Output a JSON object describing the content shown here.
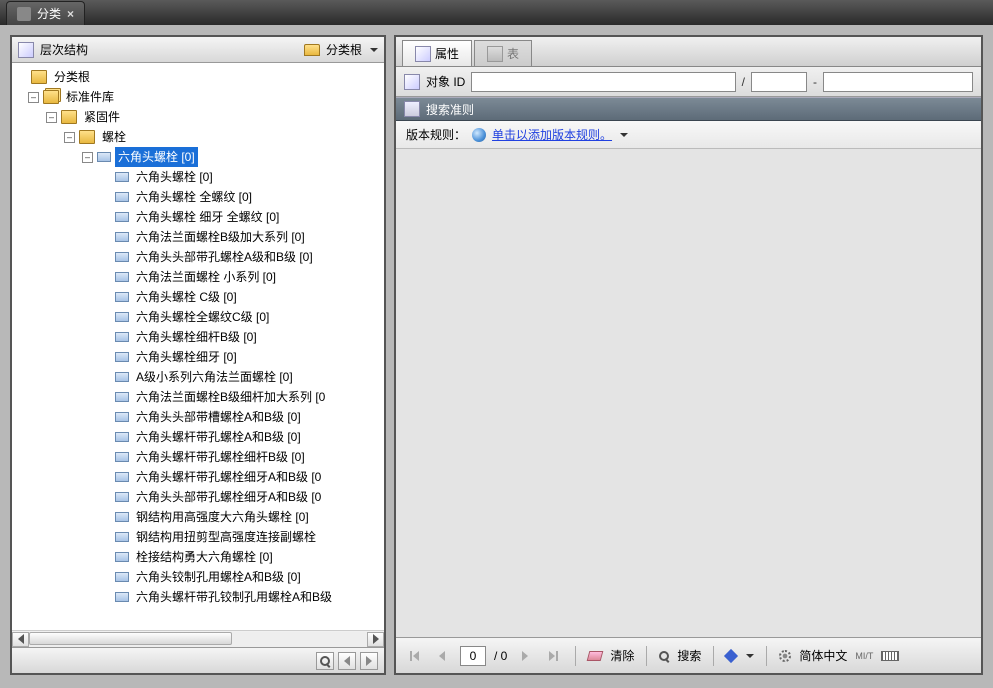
{
  "window": {
    "tab_title": "分类",
    "tab_close": "×"
  },
  "left_panel": {
    "header_title": "层次结构",
    "header_dropdown": "分类根",
    "tree": {
      "root": "分类根",
      "lib": "标准件库",
      "fastener": "紧固件",
      "bolt": "螺栓",
      "selected": "六角头螺栓  [0]",
      "items": [
        "六角头螺栓  [0]",
        "六角头螺栓 全螺纹  [0]",
        "六角头螺栓 细牙 全螺纹  [0]",
        "六角法兰面螺栓B级加大系列  [0]",
        "六角头头部带孔螺栓A级和B级  [0]",
        "六角法兰面螺栓 小系列  [0]",
        "六角头螺栓 C级  [0]",
        "六角头螺栓全螺纹C级  [0]",
        "六角头螺栓细杆B级  [0]",
        "六角头螺栓细牙  [0]",
        "A级小系列六角法兰面螺栓  [0]",
        "六角法兰面螺栓B级细杆加大系列  [0",
        "六角头头部带槽螺栓A和B级  [0]",
        "六角头螺杆带孔螺栓A和B级  [0]",
        "六角头螺杆带孔螺栓细杆B级  [0]",
        "六角头螺杆带孔螺栓细牙A和B级  [0",
        "六角头头部带孔螺栓细牙A和B级  [0",
        "钢结构用高强度大六角头螺栓  [0]",
        "钢结构用扭剪型高强度连接副螺栓  ",
        "栓接结构勇大六角螺栓  [0]",
        "六角头铰制孔用螺栓A和B级  [0]",
        "六角头螺杆带孔铰制孔用螺栓A和B级"
      ]
    }
  },
  "right_panel": {
    "tabs": {
      "props": "属性",
      "table": "表"
    },
    "obj_id_label": "对象 ID",
    "obj_id_sep1": "/",
    "obj_id_sep2": "-",
    "search_criteria_title": "搜索准则",
    "version_rule_label": "版本规则：",
    "version_rule_link": "单击以添加版本规则。"
  },
  "footer": {
    "page_current": "0",
    "page_sep": "/ 0",
    "clear": "清除",
    "search": "搜索",
    "language": "简体中文",
    "keyboard_hint": "MI/T"
  }
}
